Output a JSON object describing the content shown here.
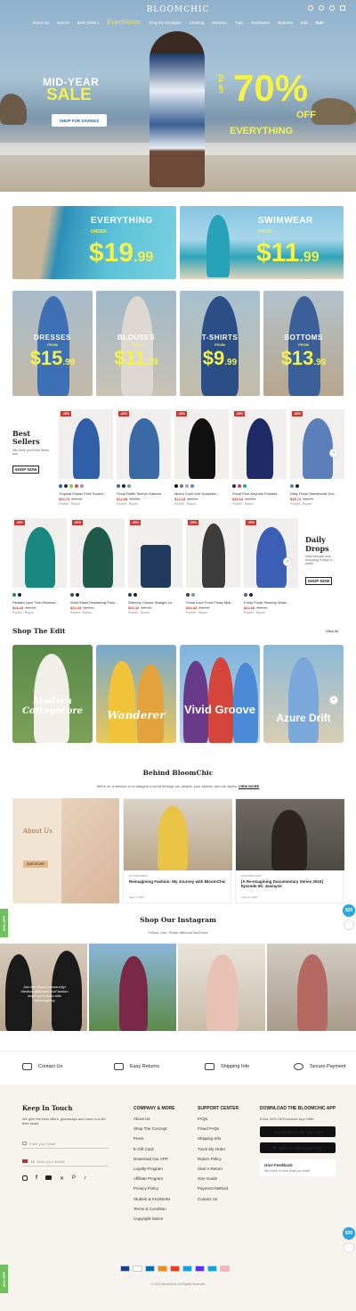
{
  "header": {
    "logo": "BLOOMCHIC",
    "nav": [
      "About Us",
      "New In",
      "Best Sellers",
      "Everbloom",
      "Shop by Occasion",
      "Clothing",
      "Dresses",
      "Tops",
      "Swimwear",
      "Bottoms",
      "Edit",
      "Sale"
    ]
  },
  "hero": {
    "line1": "MID-YEAR",
    "line2": "SALE",
    "cta": "SHOP FOR SAVINGS",
    "upto": "UP TO",
    "percent": "70%",
    "off": "OFF",
    "everything": "EVERYTHING"
  },
  "promos": [
    {
      "title": "EVERYTHING",
      "sub": "UNDER",
      "price": "$19",
      "cents": ".99"
    },
    {
      "title": "SWIMWEAR",
      "sub": "FROM",
      "price": "$11",
      "cents": ".99"
    }
  ],
  "categories": [
    {
      "title": "DRESSES",
      "from": "FROM",
      "price": "$15",
      "cents": ".99"
    },
    {
      "title": "BLOUSES",
      "from": "FROM",
      "price": "$11",
      "cents": ".99"
    },
    {
      "title": "T-SHIRTS",
      "from": "FROM",
      "price": "$9",
      "cents": ".99"
    },
    {
      "title": "BOTTOMS",
      "from": "FROM",
      "price": "$13",
      "cents": ".99"
    }
  ],
  "best_sellers": {
    "title": "Best Sellers",
    "sub": "We think you'll like these too!",
    "cta": "SHOP NOW",
    "items": [
      {
        "badge": "-25%",
        "name": "Tropical Flower Print Pocket...",
        "price": "$30.73",
        "old": "$40.98",
        "meta": "Pocket · Rayon"
      },
      {
        "badge": "-20%",
        "name": "Floral Ruffle Sleeve Gathere...",
        "price": "$12.68",
        "old": "$15.85",
        "meta": "Pocket · Rayon"
      },
      {
        "badge": "-25%",
        "name": "Mixed Color Knit Drawstrin...",
        "price": "$14.18",
        "old": "$18.90",
        "meta": "Pocket · Rayon"
      },
      {
        "badge": "-25%",
        "name": "Floral Print Keyhole Pockets...",
        "price": "$35.63",
        "old": "$39.99",
        "meta": "Pocket · Rayon"
      },
      {
        "badge": "-30%",
        "name": "Ditsy Floral Sweetheart Dra...",
        "price": "$39.73",
        "old": "$56.77",
        "meta": "Pocket · Rayon"
      }
    ]
  },
  "daily_drops": {
    "title1": "Daily",
    "title2": "Drops",
    "sub": "New arrivals now dropping 3 days a week.",
    "cta": "SHOP NOW",
    "items": [
      {
        "badge": "-25%",
        "name": "Pleated Lace Trim Relaxed...",
        "price": "$28.43",
        "old": "$37.90",
        "meta": "Pocket · Rayon"
      },
      {
        "badge": "-25%",
        "name": "Solid Waist Drawstring Pock...",
        "price": "$22.43",
        "old": "$29.90",
        "meta": "Pocket · Rayon"
      },
      {
        "badge": "-25%",
        "name": "Stretchy Classic Straight Le...",
        "price": "$20.33",
        "old": "$27.10",
        "meta": "Pocket · Denim"
      },
      {
        "badge": "-25%",
        "name": "Floral Lace Front Flowy Midi...",
        "price": "$30.83",
        "old": "$41.10",
        "meta": "Pocket · Rayon"
      },
      {
        "badge": "-25%",
        "name": "Fruity Floral Stretchy Waist ...",
        "price": "$24.68",
        "old": "$32.90",
        "meta": "Pocket · Rayon"
      }
    ]
  },
  "edit": {
    "title": "Shop The Edit",
    "view_all": "View All",
    "items": [
      "Modern Cottagecore",
      "Wanderer",
      "Vivid Groove",
      "Azure Drift"
    ]
  },
  "behind": {
    "title": "Behind BloomChic",
    "sub": "We're on a mission to re-imagine a world through our people, your stories, and our styles.",
    "more": "VIEW MORE",
    "about": "About Us",
    "about_cta": "OUR STORY",
    "s1_tag": "IN THE PRESS",
    "s1_title": "Reimagining Fashion: My Journey with BloomChic",
    "s1_date": "Sept 9, 2024",
    "s2_tag": "DOCUMENTARY",
    "s2_title": "[A Re-Imagining Documentary Series 2024] Episode 05: Jasmyne",
    "s2_date": "Aug 20, 2024"
  },
  "insta": {
    "title": "Shop Our Instagram",
    "sub": "Follow, Like, Share #BloomChicDress",
    "overlay": "Join the BloomCommunity! Mention @BloomChicFashion share your looks with #reimagining"
  },
  "services": [
    "Contact Us",
    "Easy Returns",
    "Shipping Info",
    "Secure Payment"
  ],
  "footer": {
    "keep": "Keep In Touch",
    "keep_sub": "We give the best offers, giveaways and once-in-a-life time deals.",
    "email": "Enter your email",
    "mobile": "Enter your Mobile",
    "country_code": "+1",
    "col1_title": "COMPANY & MORE",
    "col1": [
      "About Us",
      "Shop The Concept",
      "Press",
      "E-Gift Card",
      "Download Our APP",
      "Loyalty Program",
      "Affiliate Program",
      "Privacy Policy",
      "Student & KeyWorks",
      "Terms & Condition",
      "Copyright Notice"
    ],
    "col2_title": "SUPPORT CENTER",
    "col2": [
      "FAQs",
      "Fraud FAQs",
      "Shipping Info",
      "Track My Order",
      "Return Policy",
      "Start A Return",
      "Size Guide",
      "Payment Method",
      "Contact Us"
    ],
    "app_title": "DOWNLOAD THE BLOOMCHIC APP",
    "app_sub": "Extra 20% Off Exclusive App Offer",
    "appstore": "Download on the App Store",
    "gplay": "GET IT ON Google Play",
    "feedback": "Give Feedback",
    "feedback_sub": "We'd love to hear what you think!",
    "copyright": "© 2025 BloomChic All Rights Reserved"
  },
  "side": {
    "tab": "20% OFF",
    "fab": "$20"
  }
}
